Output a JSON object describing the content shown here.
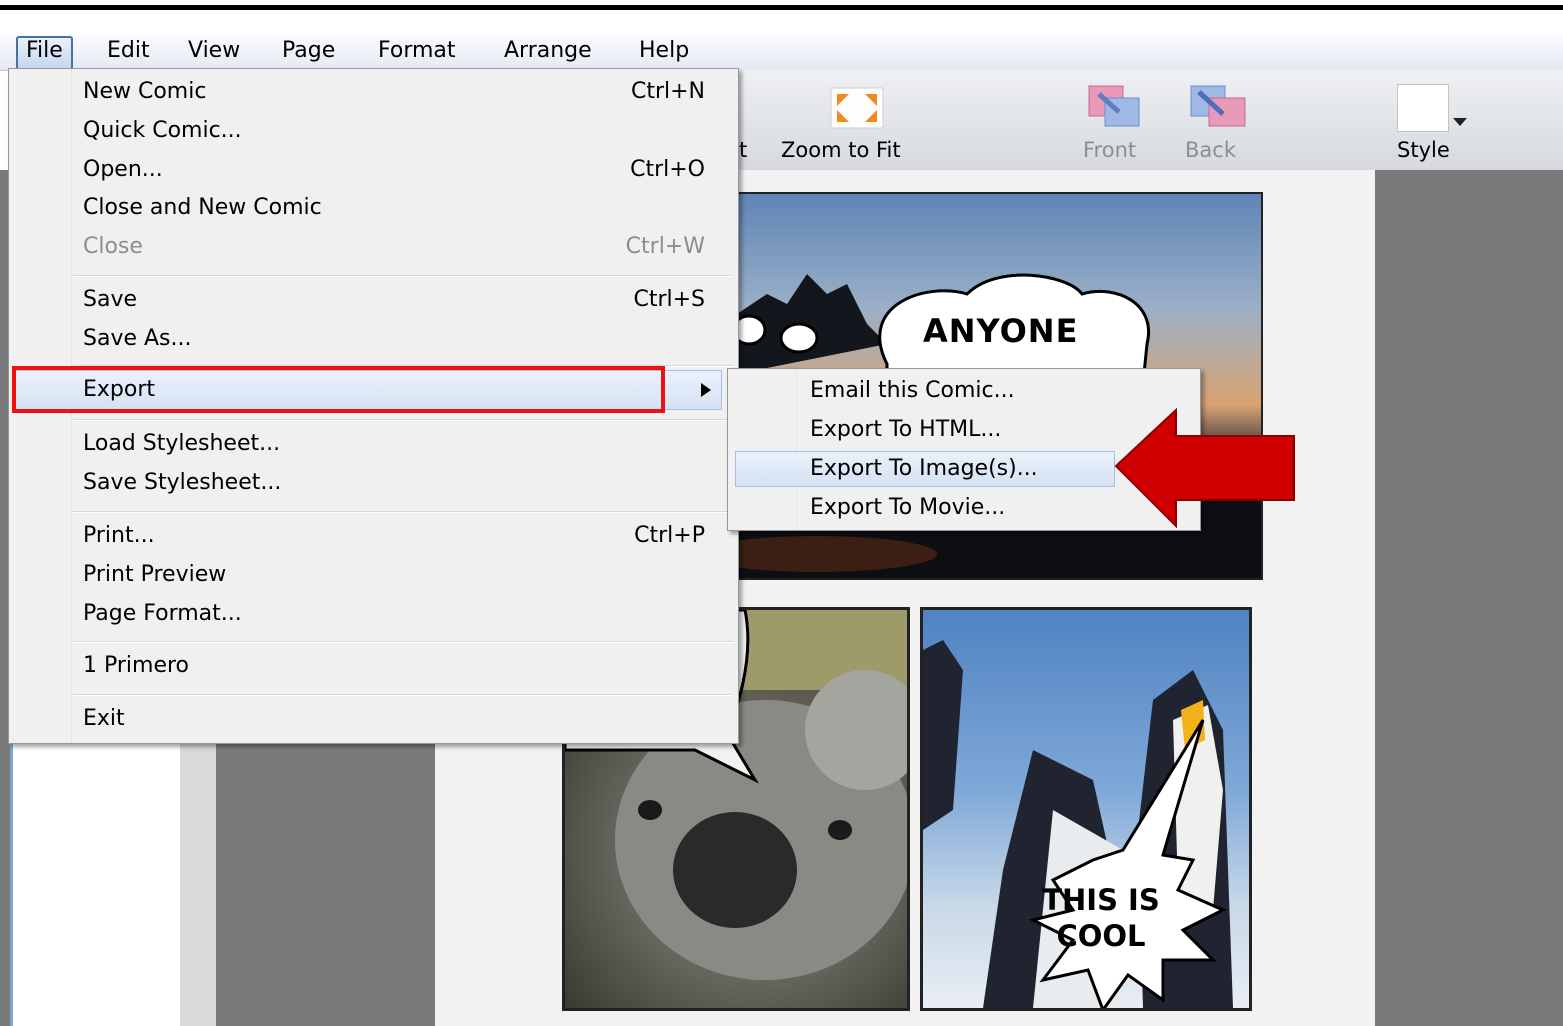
{
  "menubar": {
    "items": [
      "File",
      "Edit",
      "View",
      "Page",
      "Format",
      "Arrange",
      "Help"
    ]
  },
  "toolbar": {
    "partial_label": "t",
    "zoom_to_fit": "Zoom to Fit",
    "front": "Front",
    "back": "Back",
    "style": "Style"
  },
  "file_menu": {
    "items": [
      {
        "label": "New Comic",
        "shortcut": "Ctrl+N"
      },
      {
        "label": "Quick Comic...",
        "shortcut": ""
      },
      {
        "label": "Open...",
        "shortcut": "Ctrl+O"
      },
      {
        "label": "Close and New Comic",
        "shortcut": ""
      },
      {
        "label": "Close",
        "shortcut": "Ctrl+W",
        "disabled": true
      },
      {
        "label": "Save",
        "shortcut": "Ctrl+S"
      },
      {
        "label": "Save As...",
        "shortcut": ""
      },
      {
        "label": "Export",
        "shortcut": ""
      },
      {
        "label": "Load Stylesheet...",
        "shortcut": ""
      },
      {
        "label": "Save Stylesheet...",
        "shortcut": ""
      },
      {
        "label": "Print...",
        "shortcut": "Ctrl+P"
      },
      {
        "label": "Print Preview",
        "shortcut": ""
      },
      {
        "label": "Page Format...",
        "shortcut": ""
      },
      {
        "label": "1 Primero",
        "shortcut": ""
      },
      {
        "label": "Exit",
        "shortcut": ""
      }
    ]
  },
  "export_submenu": {
    "items": [
      "Email this Comic...",
      "Export To HTML...",
      "Export To Image(s)...",
      "Export To Movie..."
    ],
    "highlighted": "Export To Image(s)..."
  },
  "comic": {
    "bubble1": "ANYONE HAVE A",
    "bubble2_line1": "THIS IS",
    "bubble2_line2": "COOL"
  },
  "colors": {
    "annotation_red": "#dd1111",
    "arrow_red": "#cc0000",
    "menu_bg": "#f0f0f0",
    "highlight_blue": "#d5e2f3"
  }
}
